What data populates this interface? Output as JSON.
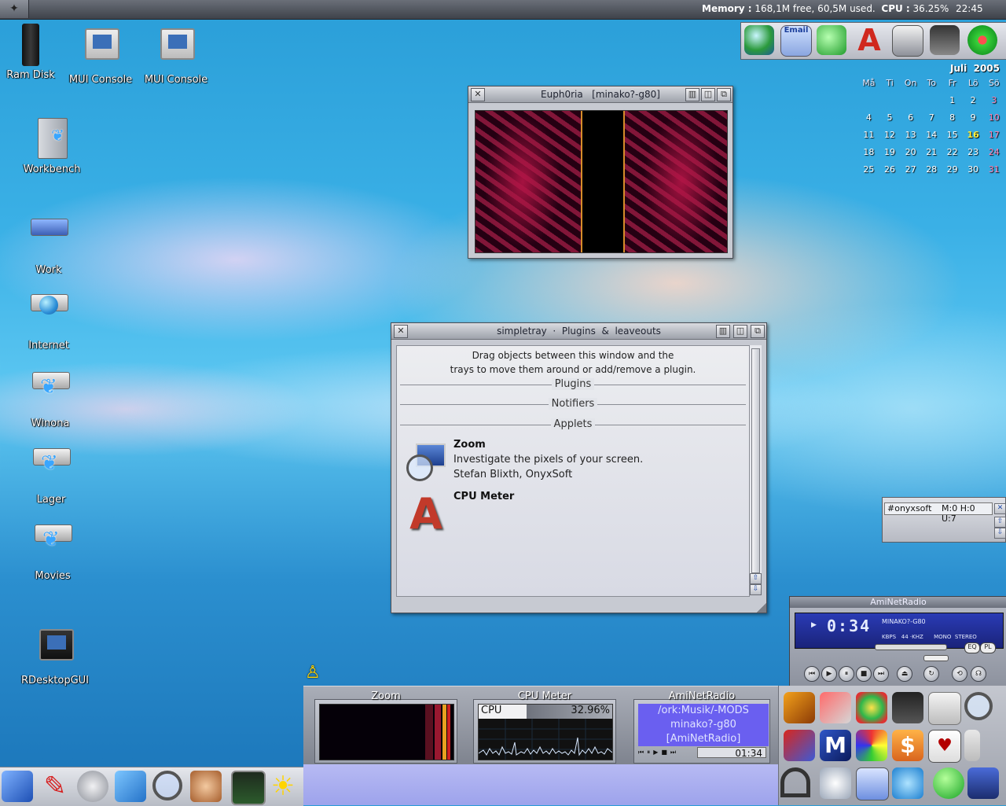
{
  "topbar": {
    "memory_label": "Memory :",
    "memory_value": "168,1M free, 60,5M used.",
    "cpu_label": "CPU :",
    "cpu_value": "36.25%",
    "clock": "22:45"
  },
  "desktop_icons": [
    {
      "label": "Ram Disk",
      "icon": "ram-disk-icon"
    },
    {
      "label": "MUI Console",
      "icon": "mui-console-icon"
    },
    {
      "label": "MUI Console",
      "icon": "mui-console-icon"
    },
    {
      "label": "Workbench",
      "icon": "workbench-icon"
    },
    {
      "label": "Work",
      "icon": "work-drive-icon"
    },
    {
      "label": "Internet",
      "icon": "internet-drive-icon"
    },
    {
      "label": "Winona",
      "icon": "winona-drive-icon"
    },
    {
      "label": "Lager",
      "icon": "lager-drive-icon"
    },
    {
      "label": "Movies",
      "icon": "movies-drive-icon"
    },
    {
      "label": "RDesktopGUI",
      "icon": "rdesktop-icon"
    }
  ],
  "euphoria_window": {
    "title": "Euph0ria   [minako?-g80]"
  },
  "simpletray_window": {
    "title": "simpletray  ·  Plugins  &  leaveouts",
    "hint_line1": "Drag objects between this window and the",
    "hint_line2": "trays to move them around or add/remove a plugin.",
    "section_plugins": "Plugins",
    "section_notifiers": "Notifiers",
    "section_applets": "Applets",
    "applets": [
      {
        "name": "Zoom",
        "description": "Investigate the pixels of your screen.",
        "author": "Stefan Blixth, OnyxSoft",
        "icon": "zoom-icon"
      },
      {
        "name": "CPU Meter",
        "description": "",
        "author": "",
        "icon": "cpu-meter-icon"
      }
    ]
  },
  "calendar": {
    "month": "Juli",
    "year": "2005",
    "weekdays": [
      "Må",
      "Ti",
      "On",
      "To",
      "Fr",
      "Lö",
      "Sö"
    ],
    "weeks": [
      [
        "",
        "",
        "",
        "",
        "1",
        "2",
        "3"
      ],
      [
        "4",
        "5",
        "6",
        "7",
        "8",
        "9",
        "10"
      ],
      [
        "11",
        "12",
        "13",
        "14",
        "15",
        "16",
        "17"
      ],
      [
        "18",
        "19",
        "20",
        "21",
        "22",
        "23",
        "24"
      ],
      [
        "25",
        "26",
        "27",
        "28",
        "29",
        "30",
        "31"
      ]
    ],
    "today": "16"
  },
  "dock_icons": [
    "globe-icon",
    "email-icon",
    "chat-icon",
    "aweb-icon",
    "display-icon",
    "news-icon",
    "icq-icon"
  ],
  "dock_email_label": "Email",
  "irc": {
    "channel": "#onyxsoft",
    "modes": "M:0 H:0 U:7"
  },
  "player": {
    "title": "AmiNetRadio",
    "time": "0:34",
    "song": "MINAKO?-G80",
    "kbps": "KBPS",
    "khz": "44 ·KHZ",
    "mono": "MONO",
    "stereo": "STEREO",
    "eq": "EQ",
    "pl": "PL"
  },
  "bottom_applets": {
    "zoom_caption": "Zoom",
    "cpu_caption": "CPU Meter",
    "cpu_label": "CPU",
    "cpu_value": "32.96%",
    "radio_caption": "AmiNetRadio",
    "radio_lines": [
      "/ork:Musik/-MODS",
      "minako?-g80",
      "[AmiNetRadio]"
    ],
    "radio_time": "01:34"
  },
  "colors": {
    "accent": "#6a5ff0",
    "calendar_today": "#ffef3a",
    "calendar_sunday": "#ff7fb0"
  }
}
